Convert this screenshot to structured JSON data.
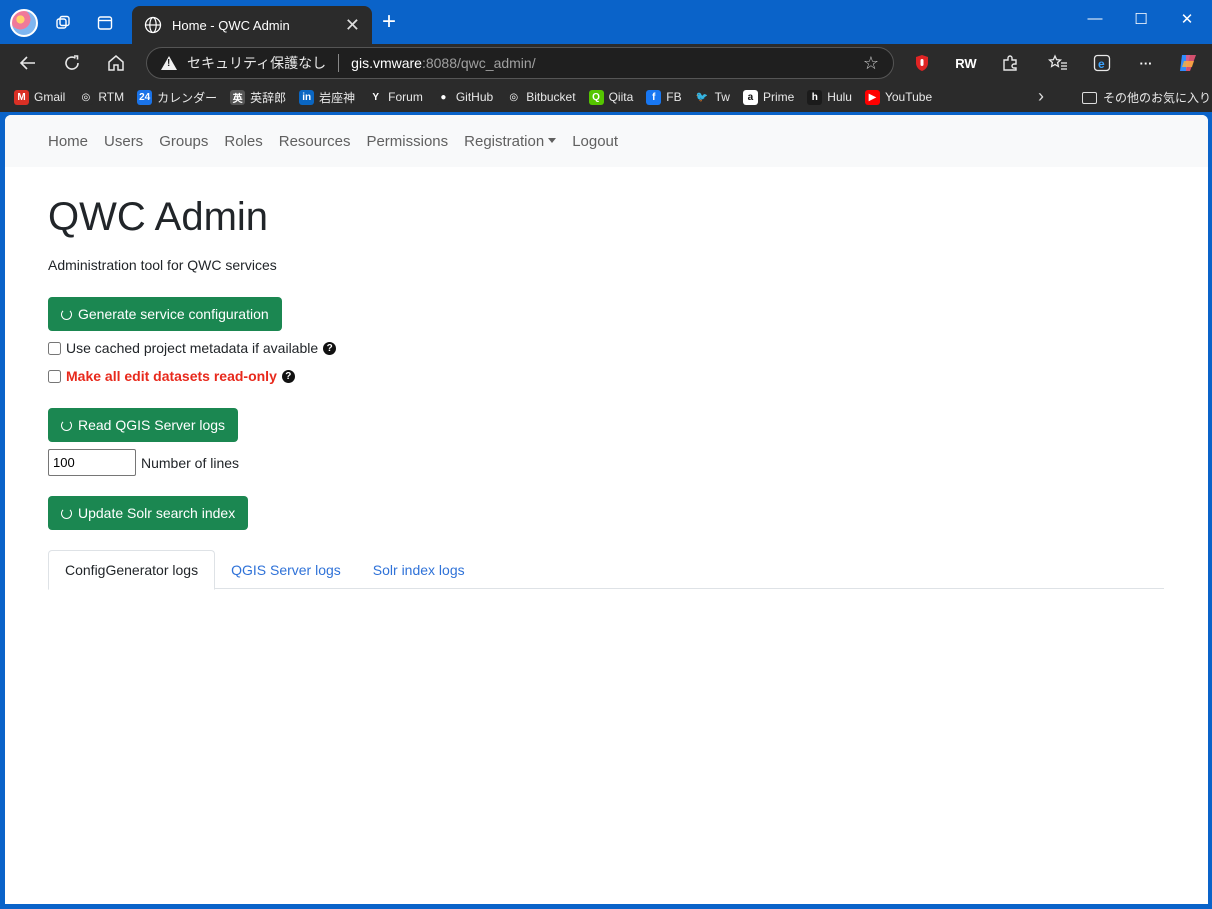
{
  "browser": {
    "tab_title": "Home - QWC Admin",
    "tab_close": "✕",
    "new_tab": "+",
    "security_label": "セキュリティ保護なし",
    "url_host": "gis.vmware",
    "url_rest": ":8088/qwc_admin/",
    "window_controls": {
      "minimize": "—",
      "maximize": "☐",
      "close": "✕"
    },
    "bookmarks": [
      {
        "label": "Gmail",
        "icon": "gmail-icon",
        "color": "#d93025",
        "glyph": "M"
      },
      {
        "label": "RTM",
        "icon": "globe-icon",
        "color": "#2b2b2b",
        "glyph": "◎"
      },
      {
        "label": "カレンダー",
        "icon": "calendar-icon",
        "color": "#1a73e8",
        "glyph": "24"
      },
      {
        "label": "英辞郎",
        "icon": "eijiro-icon",
        "color": "#555555",
        "glyph": "英"
      },
      {
        "label": "岩座神",
        "icon": "linkedin-icon",
        "color": "#0a66c2",
        "glyph": "in"
      },
      {
        "label": "Forum",
        "icon": "forum-icon",
        "color": "#2b2b2b",
        "glyph": "Y"
      },
      {
        "label": "GitHub",
        "icon": "github-icon",
        "color": "#2b2b2b",
        "glyph": "●"
      },
      {
        "label": "Bitbucket",
        "icon": "globe-icon",
        "color": "#2b2b2b",
        "glyph": "◎"
      },
      {
        "label": "Qiita",
        "icon": "qiita-icon",
        "color": "#55c500",
        "glyph": "Q"
      },
      {
        "label": "FB",
        "icon": "facebook-icon",
        "color": "#1877f2",
        "glyph": "f"
      },
      {
        "label": "Tw",
        "icon": "twitter-icon",
        "color": "#2b2b2b",
        "glyph": "🐦"
      },
      {
        "label": "Prime",
        "icon": "amazon-icon",
        "color": "#ffffff",
        "glyph": "a"
      },
      {
        "label": "Hulu",
        "icon": "hulu-icon",
        "color": "#1b1b1b",
        "glyph": "h"
      },
      {
        "label": "YouTube",
        "icon": "youtube-icon",
        "color": "#ff0000",
        "glyph": "▶"
      }
    ],
    "bookmarks_other": "その他のお気に入り",
    "extension_labels": {
      "rw": "RW"
    }
  },
  "nav": {
    "items": [
      "Home",
      "Users",
      "Groups",
      "Roles",
      "Resources",
      "Permissions",
      "Registration",
      "Logout"
    ]
  },
  "page": {
    "title": "QWC Admin",
    "subtitle": "Administration tool for QWC services",
    "generate_button": "Generate service configuration",
    "cached_metadata_label": "Use cached project metadata if available",
    "readonly_label": "Make all edit datasets read-only",
    "help_glyph": "?",
    "read_logs_button": "Read QGIS Server logs",
    "lines_value": "100",
    "lines_label": "Number of lines",
    "update_solr_button": "Update Solr search index",
    "tabs": [
      "ConfigGenerator logs",
      "QGIS Server logs",
      "Solr index logs"
    ],
    "active_tab": "ConfigGenerator logs"
  },
  "colors": {
    "accent_button": "#1b8751",
    "danger_text": "#e8291c",
    "link": "#2f72d8",
    "window_frame": "#0a63c9"
  }
}
